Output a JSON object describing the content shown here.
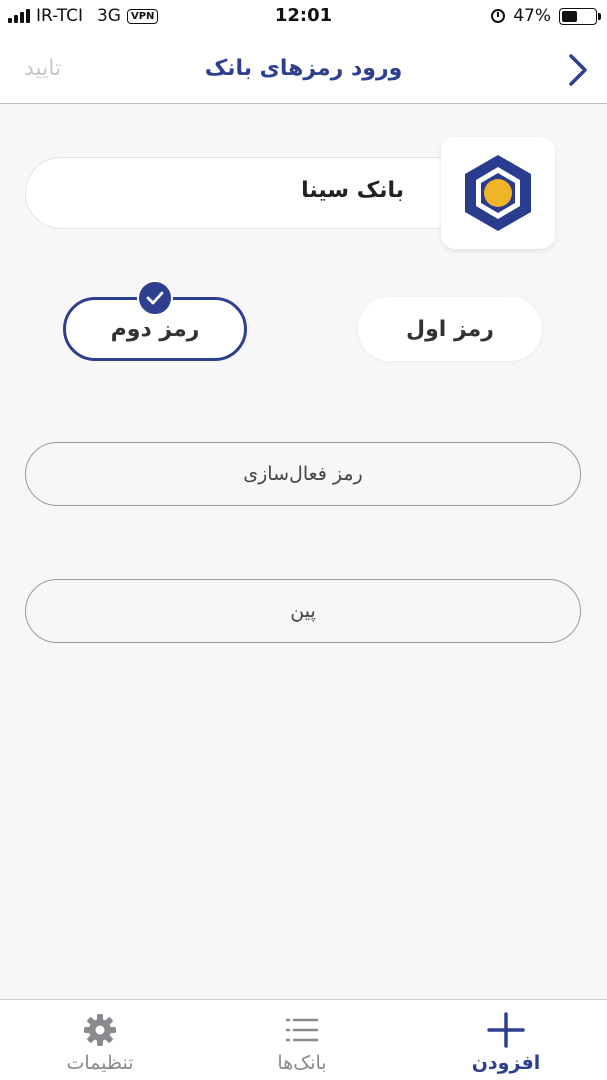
{
  "status_bar": {
    "carrier": "IR-TCI",
    "network": "3G",
    "vpn_label": "VPN",
    "time": "12:01",
    "battery_percent": "47%",
    "battery_level": 0.47
  },
  "nav": {
    "title": "ورود رمزهای بانک",
    "confirm_label": "تایید",
    "back_icon": "chevron-right-icon"
  },
  "bank": {
    "name": "بانک سینا",
    "logo_icon": "bank-sina-logo-icon",
    "colors": {
      "logo_blue": "#2a3c8e",
      "logo_gold": "#f0b429"
    }
  },
  "password_types": {
    "first_label": "رمز اول",
    "second_label": "رمز دوم",
    "selected": "second"
  },
  "fields": {
    "activation_placeholder": "رمز فعال‌سازی",
    "pin_placeholder": "پین"
  },
  "tab_bar": {
    "settings_label": "تنظیمات",
    "banks_label": "بانک‌ها",
    "add_label": "افزودن",
    "active": "add"
  },
  "colors": {
    "accent": "#2f3f8f",
    "disabled": "#c8c8cc",
    "background": "#f7f7f9"
  }
}
